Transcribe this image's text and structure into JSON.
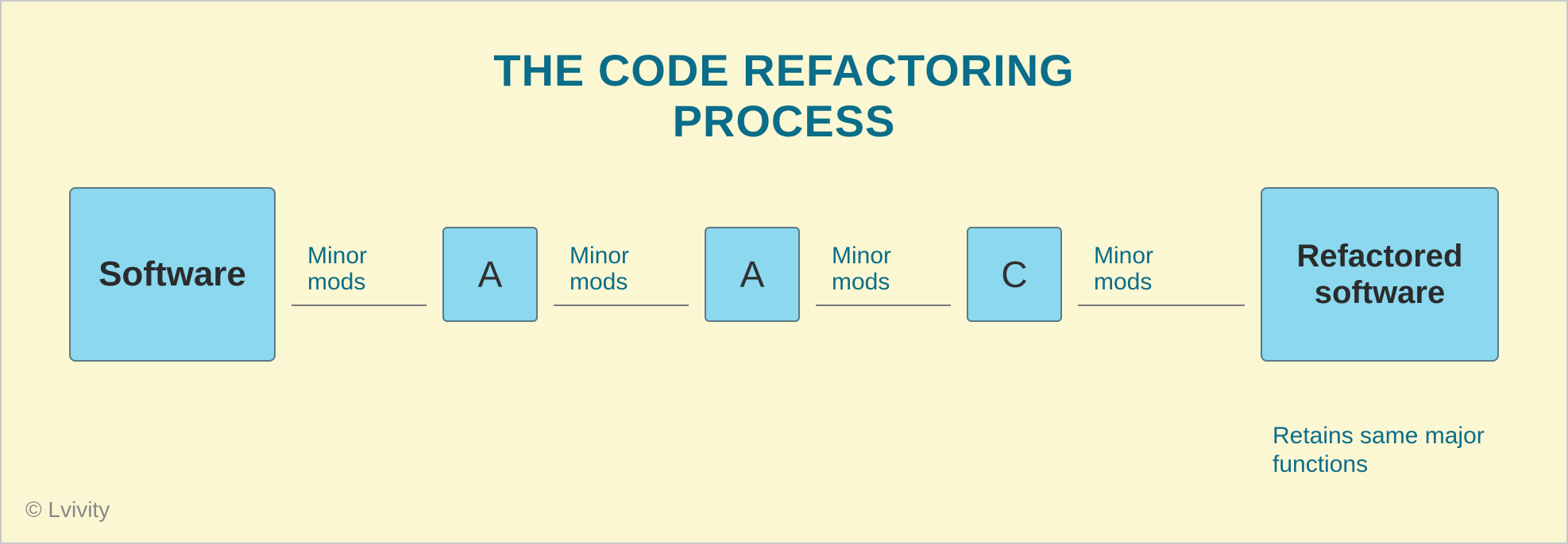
{
  "title_line1": "THE CODE REFACTORING",
  "title_line2": "PROCESS",
  "flow": {
    "start_label": "Software",
    "end_label": "Refactored software",
    "steps": [
      {
        "letter": "A"
      },
      {
        "letter": "A"
      },
      {
        "letter": "C"
      }
    ],
    "connector_label_line1": "Minor",
    "connector_label_line2": "mods"
  },
  "caption": "Retains same major functions",
  "copyright": "© Lvivity"
}
